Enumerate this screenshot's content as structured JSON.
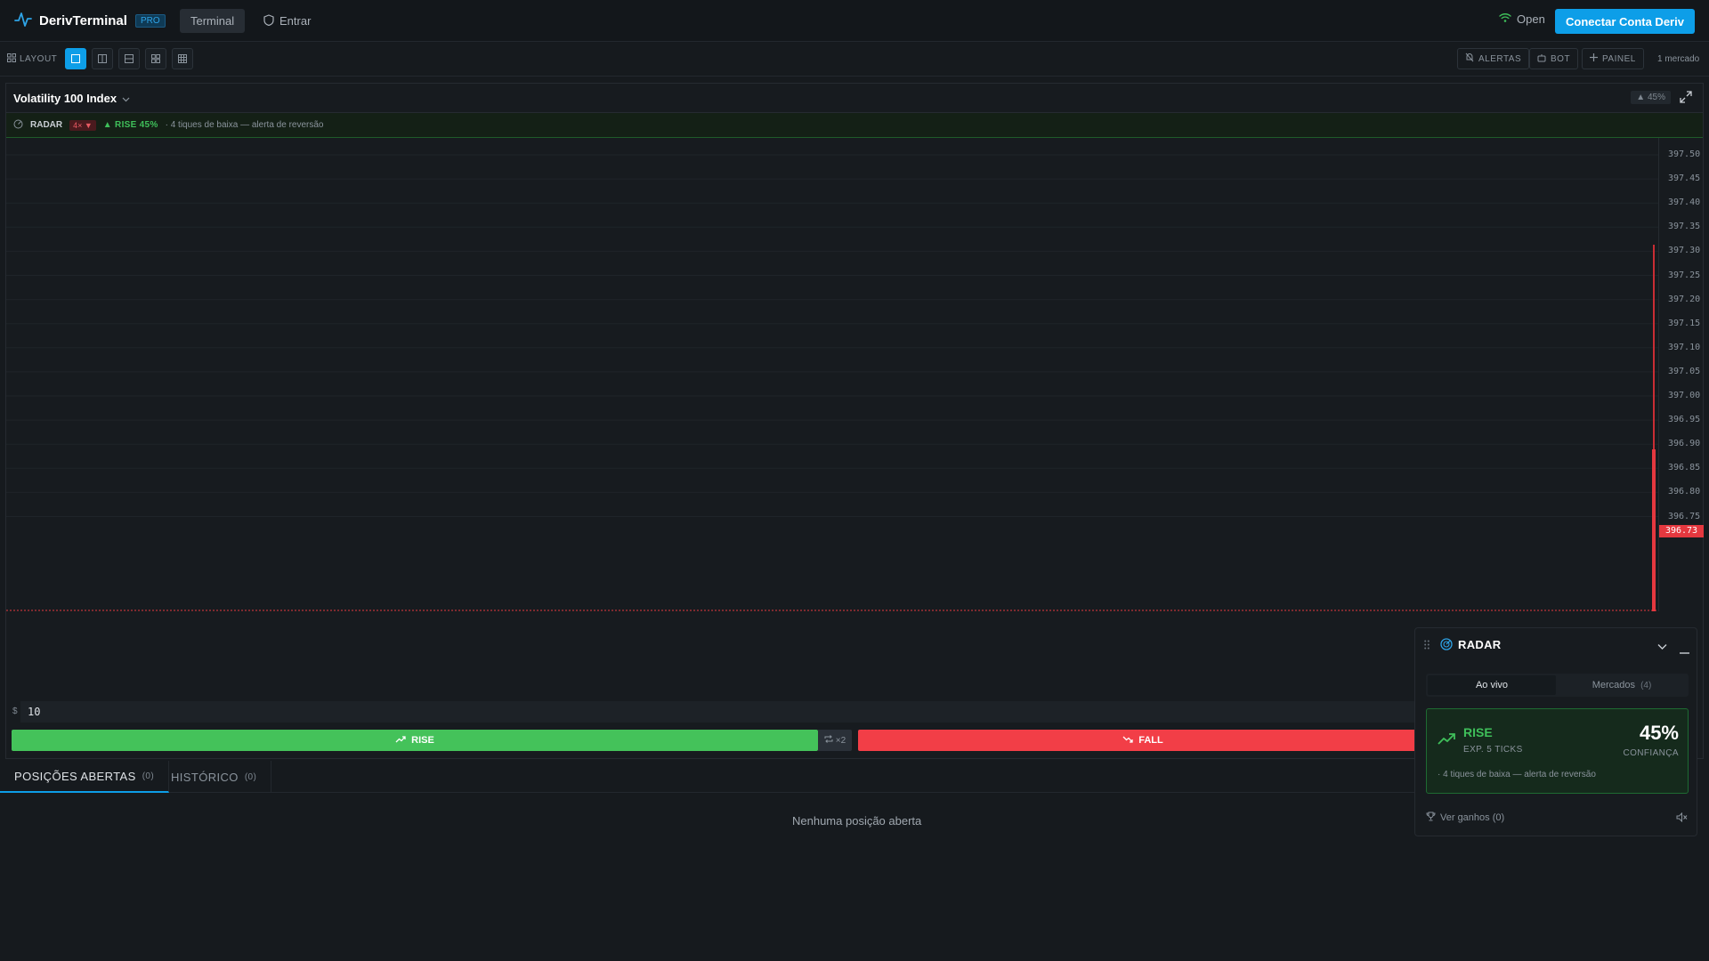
{
  "app": {
    "name": "DerivTerminal",
    "badge": "PRO",
    "nav": {
      "terminal": "Terminal",
      "login": "Entrar"
    },
    "connection_status": "Open",
    "connect_button": "Conectar Conta Deriv"
  },
  "toolbar": {
    "layout_label": "LAYOUT",
    "alerts": "ALERTAS",
    "bot": "BOT",
    "panel": "PAINEL",
    "market_count": "1 mercado"
  },
  "chart_panel": {
    "symbol": "Volatility 100 Index",
    "header_badge": "▲ 45%",
    "radar_strip": {
      "label": "RADAR",
      "count": "4× ▼",
      "signal": "▲ RISE 45%",
      "note": "· 4 tiques de baixa — alerta de reversão"
    },
    "price_ticks": [
      "397.50",
      "397.45",
      "397.40",
      "397.35",
      "397.30",
      "397.25",
      "397.20",
      "397.15",
      "397.10",
      "397.05",
      "397.00",
      "396.95",
      "396.90",
      "396.85",
      "396.80",
      "396.75"
    ],
    "current_price": "396.73",
    "amount": {
      "currency": "$",
      "value": "10"
    },
    "rise_label": "RISE",
    "multiplier": "×2",
    "fall_label": "FALL"
  },
  "positions": {
    "tabs": [
      {
        "label": "POSIÇÕES ABERTAS",
        "count": "(0)"
      },
      {
        "label": "HISTÓRICO",
        "count": "(0)"
      }
    ],
    "empty": "Nenhuma posição aberta"
  },
  "radar_widget": {
    "title": "RADAR",
    "tabs": {
      "live": "Ao vivo",
      "markets": "Mercados",
      "markets_count": "(4)"
    },
    "signal": {
      "direction": "RISE",
      "expiry": "EXP. 5 TICKS",
      "confidence": "45%",
      "confidence_label": "CONFIANÇA",
      "note": "· 4 tiques de baixa — alerta de reversão"
    },
    "footer": {
      "gains": "Ver ganhos (0)"
    }
  },
  "colors": {
    "accent": "#0d9ee8",
    "rise": "#44c25a",
    "fall": "#f23e47",
    "bg": "#161a1e"
  }
}
